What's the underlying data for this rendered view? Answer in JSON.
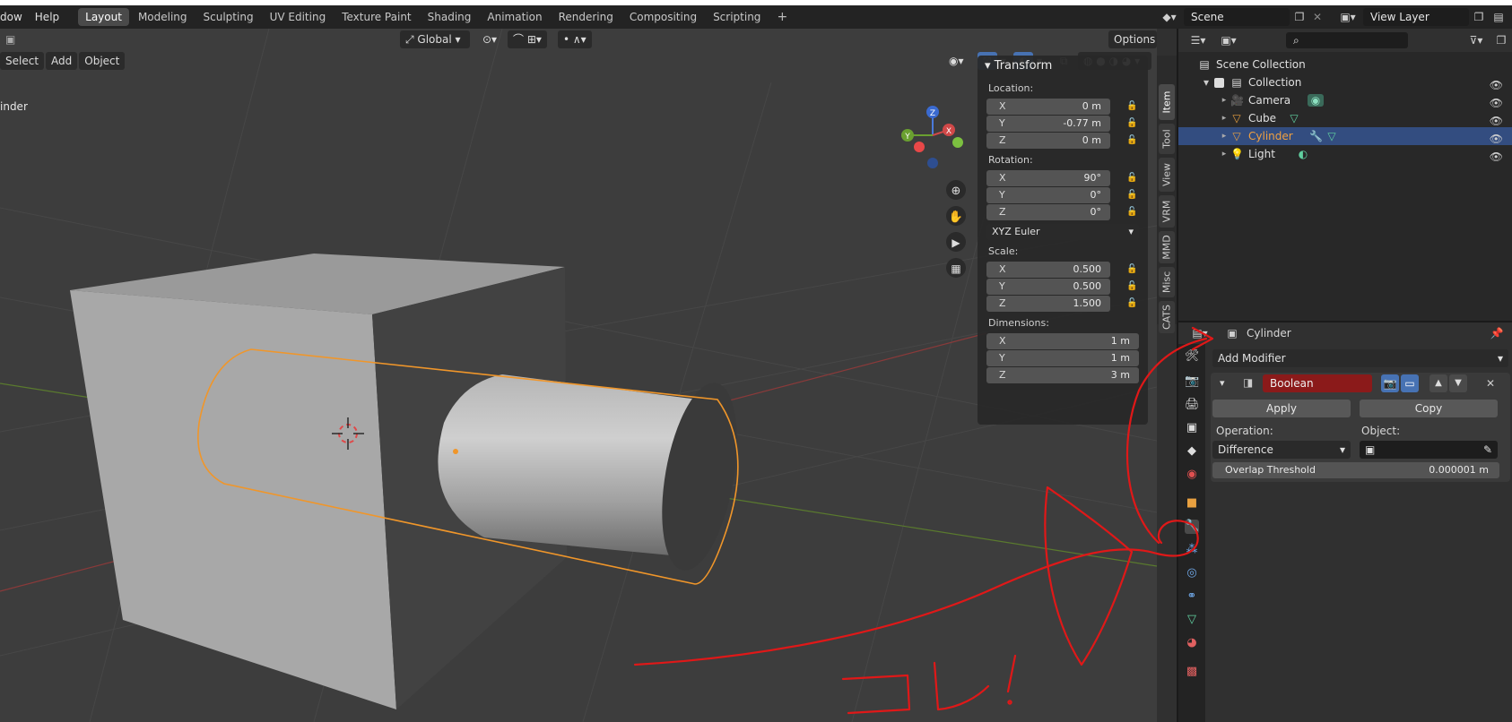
{
  "topbar": {
    "menus": [
      "dow",
      "Help"
    ],
    "workspaces": [
      "Layout",
      "Modeling",
      "Sculpting",
      "UV Editing",
      "Texture Paint",
      "Shading",
      "Animation",
      "Rendering",
      "Compositing",
      "Scripting"
    ],
    "active_workspace": "Layout",
    "add_tab": "+",
    "scene_name": "Scene",
    "view_layer": "View Layer"
  },
  "viewport": {
    "transform_orientation": "Global",
    "options_label": "Options",
    "menus": [
      "Select",
      "Add",
      "Object"
    ],
    "object_label": "inder",
    "gizmo_axes": {
      "z": "Z",
      "y": "Y",
      "x": "X"
    }
  },
  "npanel": {
    "section": "Transform",
    "location_label": "Location:",
    "location": [
      {
        "axis": "X",
        "value": "0 m"
      },
      {
        "axis": "Y",
        "value": "-0.77 m"
      },
      {
        "axis": "Z",
        "value": "0 m"
      }
    ],
    "rotation_label": "Rotation:",
    "rotation": [
      {
        "axis": "X",
        "value": "90°"
      },
      {
        "axis": "Y",
        "value": "0°"
      },
      {
        "axis": "Z",
        "value": "0°"
      }
    ],
    "rotation_mode": "XYZ Euler",
    "scale_label": "Scale:",
    "scale": [
      {
        "axis": "X",
        "value": "0.500"
      },
      {
        "axis": "Y",
        "value": "0.500"
      },
      {
        "axis": "Z",
        "value": "1.500"
      }
    ],
    "dimensions_label": "Dimensions:",
    "dimensions": [
      {
        "axis": "X",
        "value": "1 m"
      },
      {
        "axis": "Y",
        "value": "1 m"
      },
      {
        "axis": "Z",
        "value": "3 m"
      }
    ],
    "tabs": [
      "Item",
      "Tool",
      "View",
      "VRM",
      "MMD",
      "Misc",
      "CATS"
    ]
  },
  "outliner": {
    "root": "Scene Collection",
    "collection": "Collection",
    "items": [
      "Camera",
      "Cube",
      "Cylinder",
      "Light"
    ],
    "selected": "Cylinder"
  },
  "properties": {
    "object_name": "Cylinder",
    "add_modifier": "Add Modifier",
    "modifier_name": "Boolean",
    "apply_label": "Apply",
    "copy_label": "Copy",
    "operation_label": "Operation:",
    "operation_value": "Difference",
    "object_label": "Object:",
    "overlap_label": "Overlap Threshold",
    "overlap_value": "0.000001 m"
  },
  "annotation": {
    "handwritten_text": "コレ!",
    "color": "#e01818"
  },
  "colors": {
    "selection_orange": "#f0962a",
    "modifier_name_bg": "#8b1a1a",
    "outliner_selected": "#334d80"
  }
}
